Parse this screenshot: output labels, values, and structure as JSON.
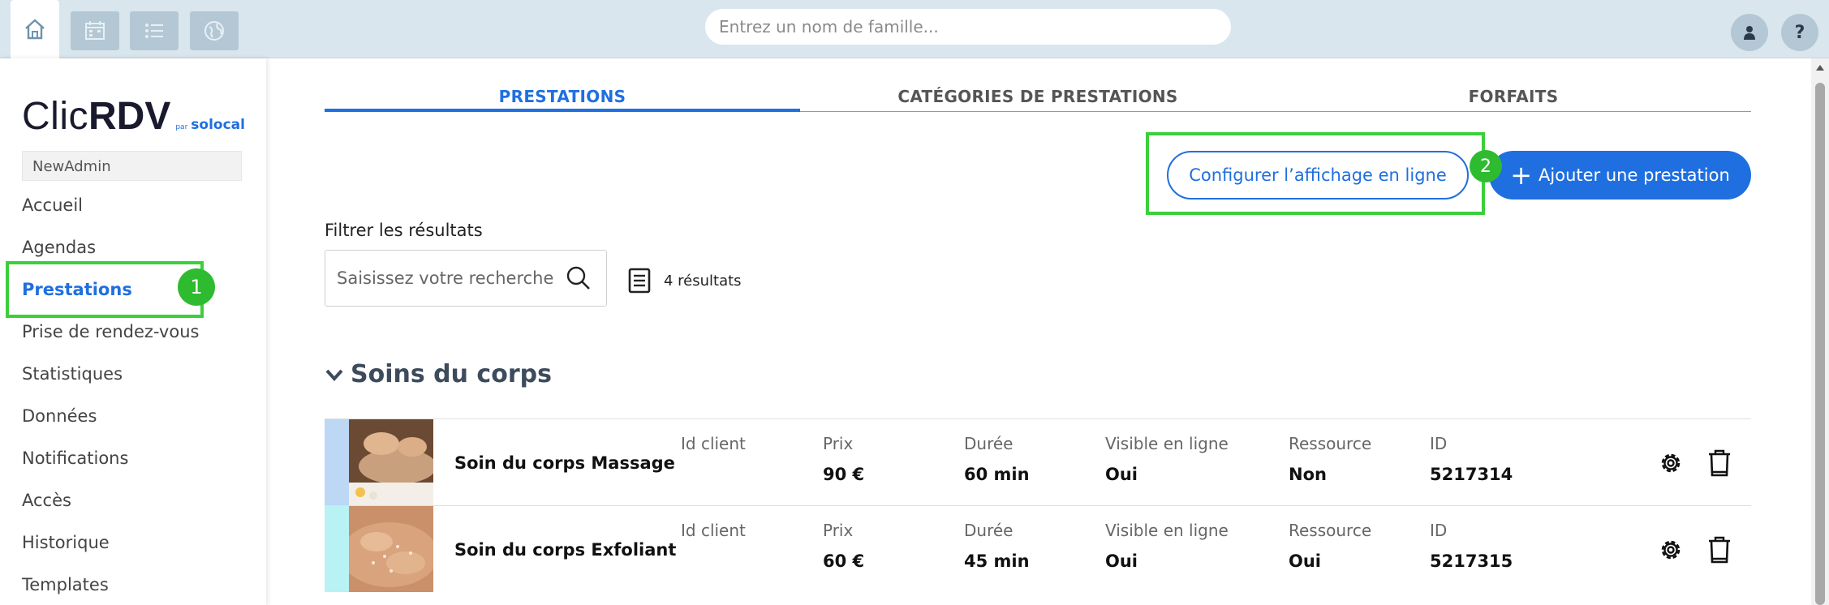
{
  "topbar": {
    "nav_icons": [
      "home-icon",
      "calendar-icon",
      "list-icon",
      "globe-icon"
    ],
    "search_placeholder": "Entrez un nom de famille...",
    "user_icon": "user-icon",
    "help_label": "?"
  },
  "sidebar": {
    "logo": {
      "clic": "Clic",
      "rdv": "RDV",
      "par": "par",
      "solocal": "solocal"
    },
    "account": "NewAdmin",
    "items": [
      {
        "label": "Accueil",
        "active": false
      },
      {
        "label": "Agendas",
        "active": false
      },
      {
        "label": "Prestations",
        "active": true
      },
      {
        "label": "Prise de rendez-vous",
        "active": false
      },
      {
        "label": "Statistiques",
        "active": false
      },
      {
        "label": "Données",
        "active": false
      },
      {
        "label": "Notifications",
        "active": false
      },
      {
        "label": "Accès",
        "active": false
      },
      {
        "label": "Historique",
        "active": false
      },
      {
        "label": "Templates",
        "active": false
      }
    ]
  },
  "annotations": {
    "badge1": "1",
    "badge2": "2"
  },
  "tabs": [
    {
      "label": "PRESTATIONS",
      "active": true
    },
    {
      "label": "CATÉGORIES DE PRESTATIONS",
      "active": false
    },
    {
      "label": "FORFAITS",
      "active": false
    }
  ],
  "actions": {
    "configure_label": "Configurer l’affichage en ligne",
    "add_label": "Ajouter une prestation",
    "add_icon": "+"
  },
  "filter": {
    "label": "Filtrer les résultats",
    "placeholder": "Saisissez votre recherche",
    "results_count": "4 résultats"
  },
  "section": {
    "title": "Soins du corps"
  },
  "columns": {
    "client": "Id client",
    "price": "Prix",
    "duration": "Durée",
    "visible": "Visible en ligne",
    "resource": "Ressource",
    "id": "ID"
  },
  "rows": [
    {
      "name": "Soin du corps Massage",
      "client": "",
      "price": "90 €",
      "duration": "60 min",
      "visible": "Oui",
      "resource": "Non",
      "id": "5217314",
      "stripe_color": "#bcd8f5"
    },
    {
      "name": "Soin du corps Exfoliant",
      "client": "",
      "price": "60 €",
      "duration": "45 min",
      "visible": "Oui",
      "resource": "Oui",
      "id": "5217315",
      "stripe_color": "#b8f2f4"
    }
  ],
  "colors": {
    "accent": "#1f6fe0",
    "highlight": "#3ccf3c",
    "topbar": "#d9e6ee"
  }
}
